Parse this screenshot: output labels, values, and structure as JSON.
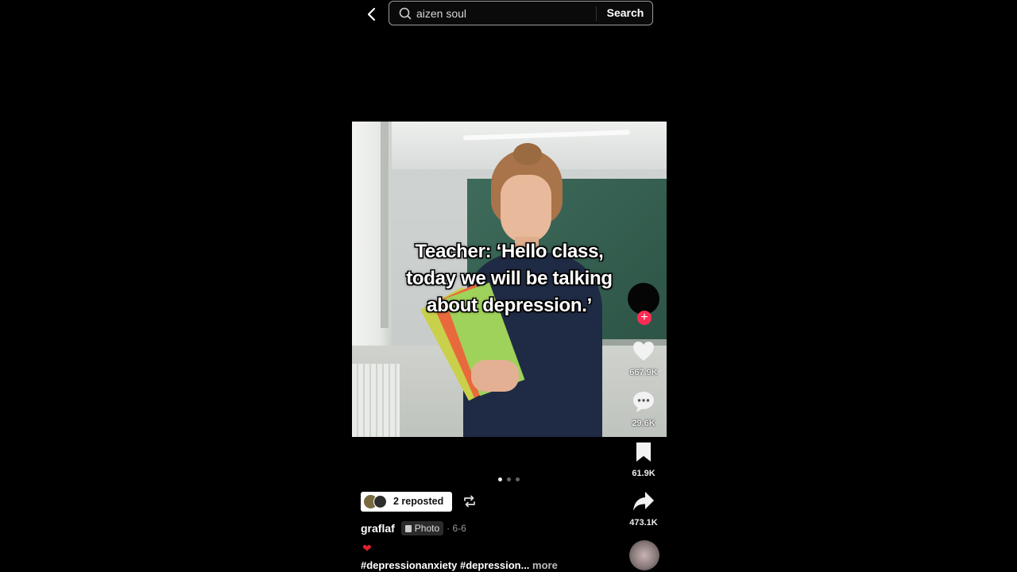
{
  "search": {
    "value": "aizen soul",
    "button_label": "Search"
  },
  "post": {
    "caption": "Teacher: ‘Hello class, today we will be talking about depression.’",
    "caption_lines": [
      "Teacher: ‘Hello class,",
      "today we will be talking",
      "about depression.’"
    ],
    "carousel": {
      "count": 3,
      "active": 0
    },
    "repost_label": "2 reposted",
    "username": "graflaf",
    "type_badge": "Photo",
    "date": "· 6-6",
    "emoji": "❤",
    "hashtags": "#depressionanxiety #depression...",
    "more_label": "more"
  },
  "actions": {
    "follow_symbol": "+",
    "likes": "667.9K",
    "comments": "29.6K",
    "saves": "61.9K",
    "shares": "473.1K"
  },
  "colors": {
    "background": "#000000",
    "accent": "#fe2c55",
    "text": "#ffffff"
  },
  "icons": [
    "back-arrow-icon",
    "search-icon",
    "heart-icon",
    "comment-icon",
    "bookmark-icon",
    "share-icon",
    "repost-icon",
    "photo-icon",
    "music-disc-icon"
  ]
}
